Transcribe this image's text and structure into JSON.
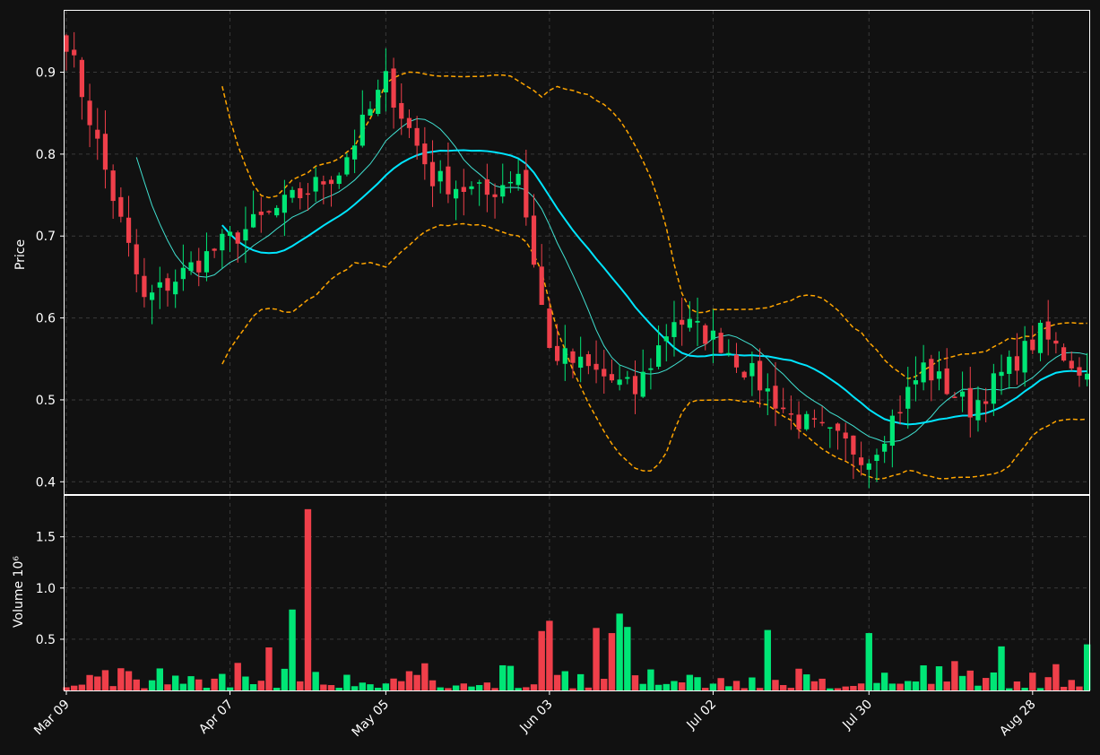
{
  "chart_data": [
    {
      "type": "candlestick",
      "ylabel": "Price",
      "ylim": [
        0.385,
        0.975
      ],
      "yticks": [
        "0.4",
        "0.5",
        "0.6",
        "0.7",
        "0.8",
        "0.9"
      ],
      "grid": true,
      "colors": {
        "up": "#00e676",
        "down": "#ef3f4a",
        "ma_fast": "#40e0d0",
        "ma_slow": "#00e5ff",
        "bands": "#ffa500",
        "background": "#111111",
        "grid": "#3a3a3a"
      },
      "date_ticks": [
        "Mar 09",
        "Apr 07",
        "May 05",
        "Jun 03",
        "Jul 02",
        "Jul 30",
        "Aug 28"
      ],
      "date_tick_index": [
        0,
        21,
        41,
        62,
        83,
        103,
        124
      ],
      "n_bars": 132,
      "key_points": [
        {
          "i": 0,
          "close": 0.94
        },
        {
          "i": 10,
          "close": 0.62
        },
        {
          "i": 20,
          "close": 0.69
        },
        {
          "i": 35,
          "close": 0.78
        },
        {
          "i": 41,
          "close": 0.89
        },
        {
          "i": 47,
          "close": 0.77
        },
        {
          "i": 54,
          "close": 0.75
        },
        {
          "i": 58,
          "close": 0.78
        },
        {
          "i": 62,
          "close": 0.56
        },
        {
          "i": 73,
          "close": 0.51
        },
        {
          "i": 78,
          "close": 0.6
        },
        {
          "i": 84,
          "close": 0.57
        },
        {
          "i": 93,
          "close": 0.48
        },
        {
          "i": 103,
          "close": 0.43
        },
        {
          "i": 110,
          "close": 0.54
        },
        {
          "i": 116,
          "close": 0.49
        },
        {
          "i": 125,
          "close": 0.58
        },
        {
          "i": 131,
          "close": 0.53
        }
      ],
      "ma_fast_period": 10,
      "ma_slow_period": 20,
      "ma_fast_start_index": 9,
      "ma_slow_start_index": 20
    },
    {
      "type": "bar",
      "ylabel": "Volume  10⁶",
      "ylim": [
        0,
        1.9
      ],
      "yticks": [
        "0.5",
        "1.0",
        "1.5"
      ],
      "grid": true,
      "spikes": [
        {
          "i": 31,
          "value": 1.77
        },
        {
          "i": 29,
          "value": 0.79
        },
        {
          "i": 26,
          "value": 0.42
        },
        {
          "i": 61,
          "value": 0.58
        },
        {
          "i": 62,
          "value": 0.68
        },
        {
          "i": 68,
          "value": 0.61
        },
        {
          "i": 70,
          "value": 0.56
        },
        {
          "i": 71,
          "value": 0.75
        },
        {
          "i": 72,
          "value": 0.62
        },
        {
          "i": 90,
          "value": 0.59
        },
        {
          "i": 103,
          "value": 0.56
        },
        {
          "i": 120,
          "value": 0.43
        },
        {
          "i": 131,
          "value": 0.45
        }
      ]
    }
  ]
}
